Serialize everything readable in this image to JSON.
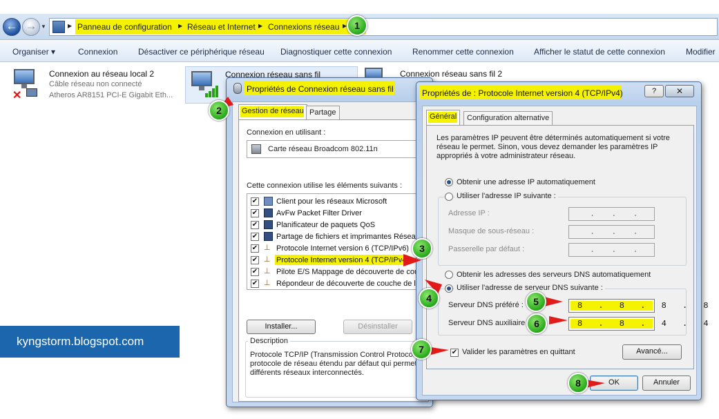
{
  "address": {
    "breadcrumbs": [
      "Panneau de configuration",
      "Réseau et Internet",
      "Connexions réseau"
    ]
  },
  "toolbar": {
    "items": [
      "Organiser ▾",
      "Connexion",
      "Désactiver ce périphérique réseau",
      "Diagnostiquer cette connexion",
      "Renommer cette connexion",
      "Afficher le statut de cette connexion",
      "Modifier"
    ]
  },
  "connections": [
    {
      "name": "Connexion au réseau local 2",
      "status": "Câble réseau non connecté",
      "adapter": "Atheros AR8151 PCI-E Gigabit Eth..."
    },
    {
      "name": "Connexion réseau sans fil"
    },
    {
      "name": "Connexion réseau sans fil 2"
    }
  ],
  "props_dialog": {
    "title": "Propriétés de Connexion réseau sans fil",
    "tabs": [
      "Gestion de réseau",
      "Partage"
    ],
    "connect_using_label": "Connexion en utilisant :",
    "adapter": "Carte réseau Broadcom 802.11n",
    "items_label": "Cette connexion utilise les éléments suivants :",
    "items": [
      "Client pour les réseaux Microsoft",
      "AvFw Packet Filter Driver",
      "Planificateur de paquets QoS",
      "Partage de fichiers et imprimantes Réseaux",
      "Protocole Internet version 6 (TCP/IPv6)",
      "Protocole Internet version 4 (TCP/IPv4)",
      "Pilote E/S Mappage de découverte de cou",
      "Répondeur de découverte de couche de lia"
    ],
    "install_button": "Installer...",
    "uninstall_button": "Désinstaller",
    "description_label": "Description",
    "description_lines": [
      "Protocole TCP/IP (Transmission Control Protocol/",
      "protocole de réseau étendu par défaut qui permet",
      "différents réseaux interconnectés."
    ]
  },
  "ipv4_dialog": {
    "title": "Propriétés de : Protocole Internet version 4 (TCP/IPv4)",
    "help_button": "?",
    "tabs": [
      "Général",
      "Configuration alternative"
    ],
    "intro_lines": [
      "Les paramètres IP peuvent être déterminés automatiquement si votre",
      "réseau le permet. Sinon, vous devez demander les paramètres IP",
      "appropriés à votre administrateur réseau."
    ],
    "auto_ip": "Obtenir une adresse IP automatiquement",
    "manual_ip": "Utiliser l'adresse IP suivante :",
    "ip_address_label": "Adresse IP :",
    "subnet_label": "Masque de sous-réseau :",
    "gateway_label": "Passerelle par défaut :",
    "auto_dns": "Obtenir les adresses des serveurs DNS automatiquement",
    "manual_dns": "Utiliser l'adresse de serveur DNS suivante :",
    "preferred_dns_label": "Serveur DNS préféré :",
    "preferred_dns": "8 . 8 . 8 . 8",
    "alternate_dns_label": "Serveur DNS auxiliaire :",
    "alternate_dns": "8 . 8 . 4 . 4",
    "validate_label": "Valider les paramètres en quittant",
    "advanced_button": "Avancé...",
    "ok_button": "OK",
    "cancel_button": "Annuler"
  },
  "steps": [
    "1",
    "2",
    "3",
    "4",
    "5",
    "6",
    "7",
    "8"
  ],
  "brand": "kyngstorm.blogspot.com",
  "colors": {
    "highlight": "#f5f200",
    "badge": "#2fae21",
    "arrow": "#e21a1a",
    "brand": "#1b66ad"
  }
}
